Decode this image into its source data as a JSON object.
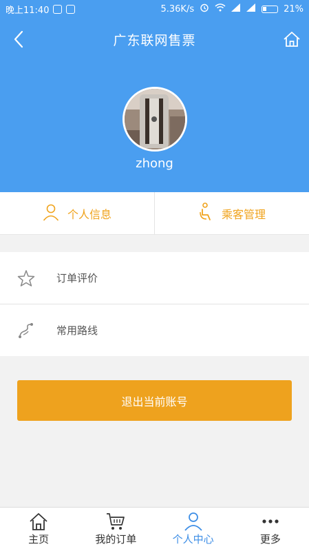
{
  "status_bar": {
    "time": "晚上11:40",
    "network_speed": "5.36K/s",
    "battery": "21%"
  },
  "header": {
    "title": "广东联网售票",
    "username": "zhong"
  },
  "quick_actions": [
    {
      "label": "个人信息",
      "icon": "user-icon"
    },
    {
      "label": "乘客管理",
      "icon": "passenger-icon"
    }
  ],
  "menu": [
    {
      "label": "订单评价",
      "icon": "star-icon"
    },
    {
      "label": "常用路线",
      "icon": "route-icon"
    }
  ],
  "logout_label": "退出当前账号",
  "tabbar": {
    "active": "个人中心",
    "tabs": [
      {
        "label": "主页",
        "icon": "home-icon"
      },
      {
        "label": "我的订单",
        "icon": "cart-icon"
      },
      {
        "label": "个人中心",
        "icon": "person-icon"
      },
      {
        "label": "更多",
        "icon": "more-icon"
      }
    ]
  },
  "colors": {
    "header_blue": "#4a9ef0",
    "accent_orange": "#eea21e",
    "active_tab_blue": "#3d8ee6"
  }
}
